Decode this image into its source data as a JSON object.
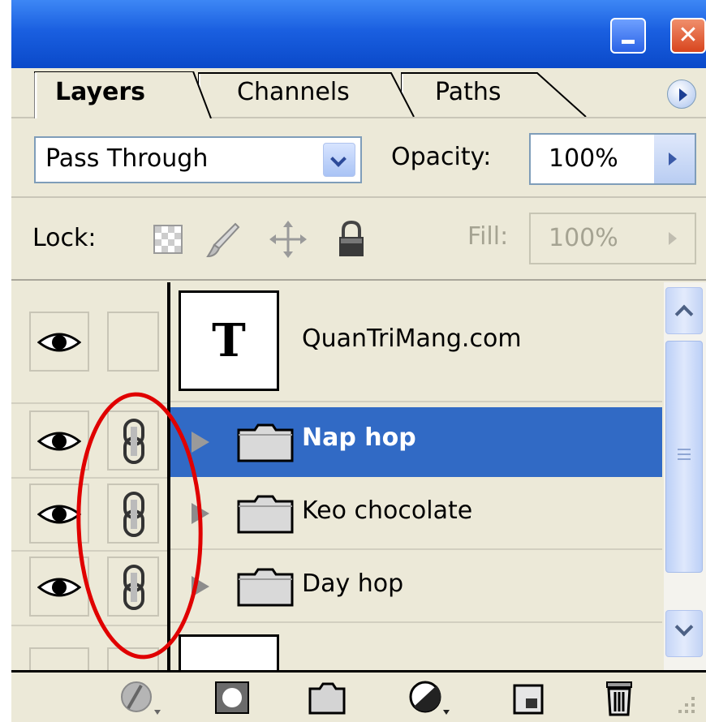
{
  "tabs": {
    "layers": "Layers",
    "channels": "Channels",
    "paths": "Paths"
  },
  "blend": {
    "mode": "Pass Through"
  },
  "opacity": {
    "label": "Opacity:",
    "value": "100%"
  },
  "lock": {
    "label": "Lock:"
  },
  "fill": {
    "label": "Fill:",
    "value": "100%"
  },
  "layers": [
    {
      "name": "QuanTriMang.com",
      "type": "text",
      "thumb_glyph": "T",
      "selected": false
    },
    {
      "name": "Nap hop",
      "type": "group",
      "selected": true
    },
    {
      "name": "Keo chocolate",
      "type": "group",
      "selected": false
    },
    {
      "name": "Day hop",
      "type": "group",
      "selected": false
    }
  ],
  "colors": {
    "titlebar": "#0a49c9",
    "panel": "#ece9d8",
    "selection": "#316ac5",
    "annotation": "#e00000"
  }
}
